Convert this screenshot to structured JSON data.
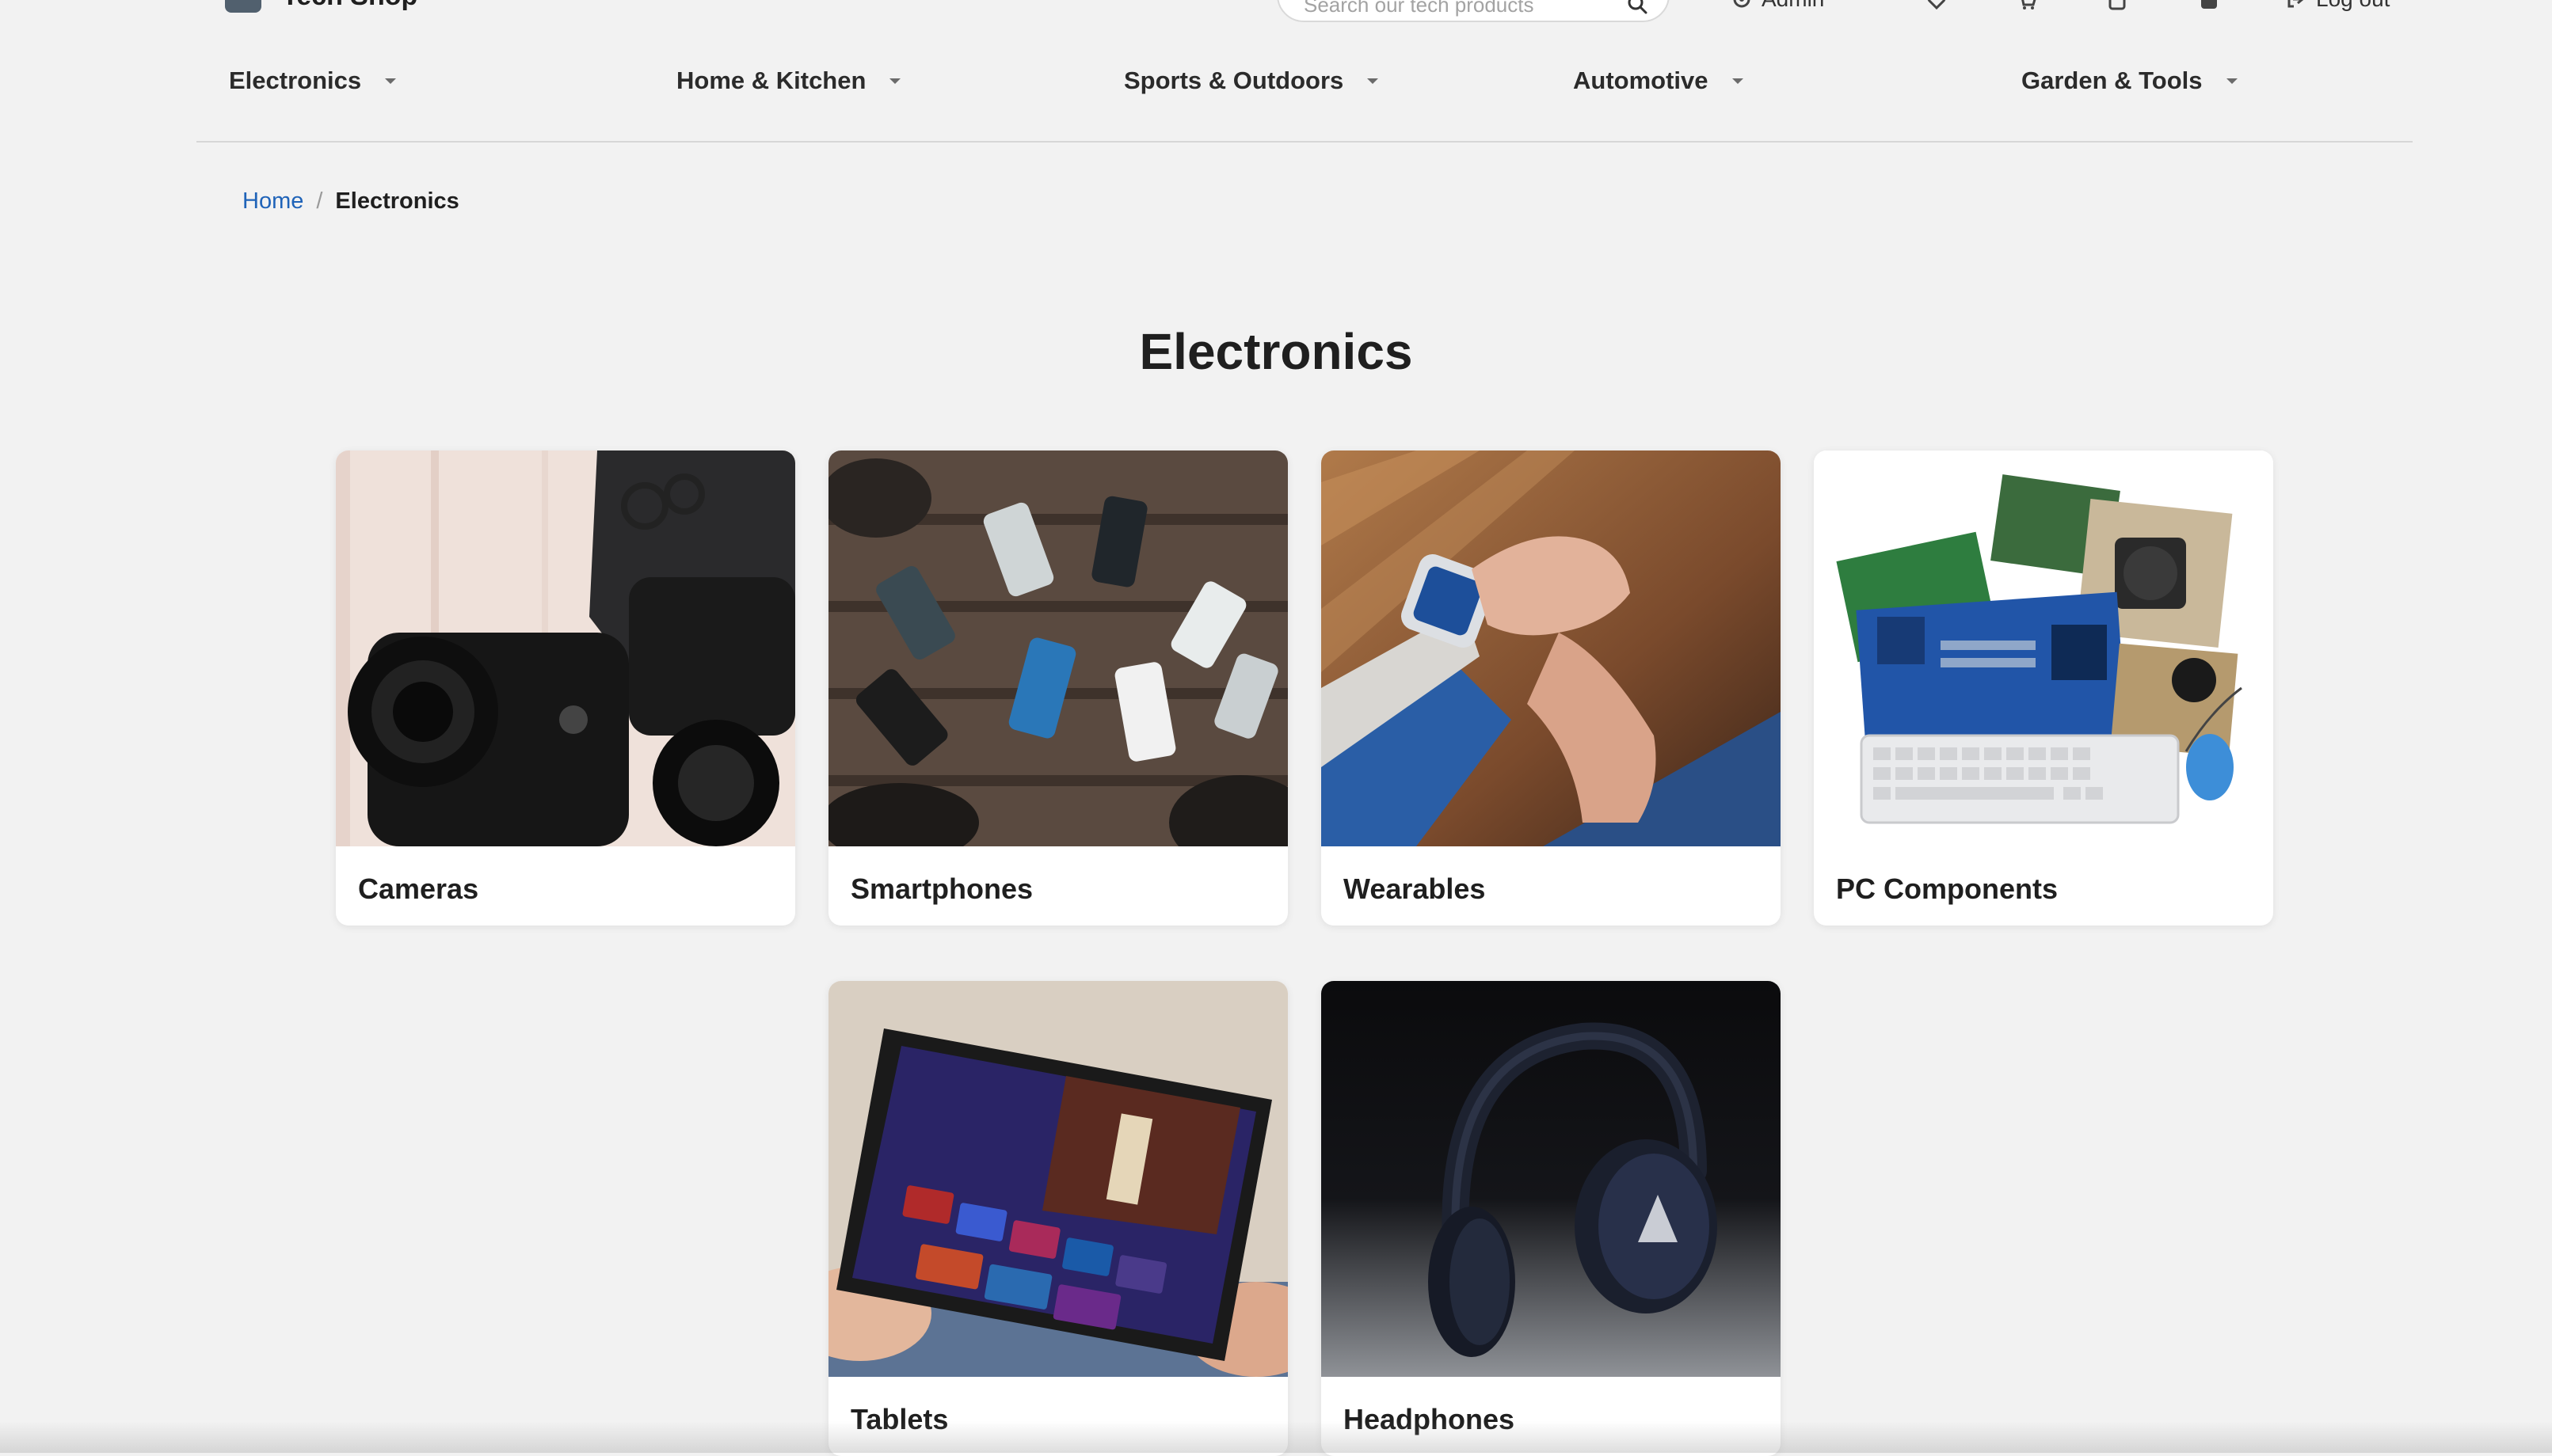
{
  "header": {
    "logo_text": "Tech Shop",
    "search_placeholder": "Search our tech products",
    "admin_label": "Admin",
    "logout_label": "Log out"
  },
  "nav": {
    "items": [
      {
        "label": "Electronics"
      },
      {
        "label": "Home & Kitchen"
      },
      {
        "label": "Sports & Outdoors"
      },
      {
        "label": "Automotive"
      },
      {
        "label": "Garden & Tools"
      }
    ]
  },
  "breadcrumb": {
    "home": "Home",
    "separator": "/",
    "current": "Electronics"
  },
  "page": {
    "title": "Electronics"
  },
  "categories": [
    {
      "label": "Cameras",
      "image_icon": "camera-photo"
    },
    {
      "label": "Smartphones",
      "image_icon": "smartphones-photo"
    },
    {
      "label": "Wearables",
      "image_icon": "smartwatch-photo"
    },
    {
      "label": "PC Components",
      "image_icon": "pc-components-photo"
    },
    {
      "label": "Tablets",
      "image_icon": "tablet-photo"
    },
    {
      "label": "Headphones",
      "image_icon": "headphones-photo"
    }
  ],
  "colors": {
    "page_background": "#f2f2f2",
    "link": "#1f63b8",
    "card_background": "#ffffff",
    "text": "#1f1f1f"
  }
}
